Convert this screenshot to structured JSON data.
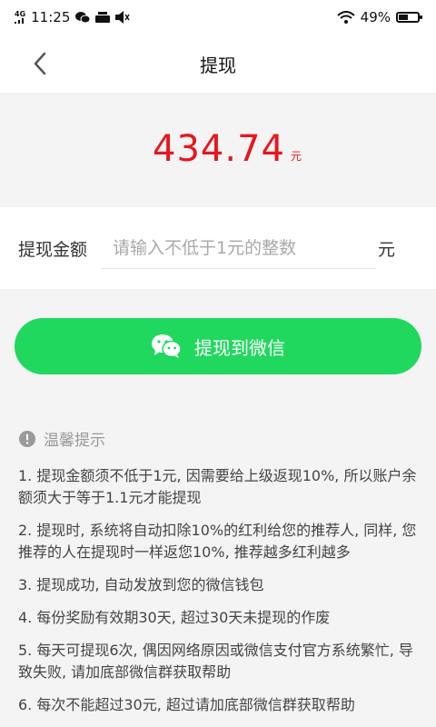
{
  "status_bar": {
    "network": "4G",
    "time": "11:25",
    "battery": "49%"
  },
  "nav": {
    "title": "提现"
  },
  "balance": {
    "amount": "434.74",
    "unit": "元"
  },
  "withdraw_form": {
    "label": "提现金额",
    "placeholder": "请输入不低于1元的整数",
    "value": "",
    "unit": "元"
  },
  "withdraw_button": {
    "label": "提现到微信",
    "icon": "wechat-icon"
  },
  "tips": {
    "title": "温馨提示",
    "items": [
      "1. 提现金额须不低于1元, 因需要给上级返现10%, 所以账户余额须大于等于1.1元才能提现",
      "2. 提现时, 系统将自动扣除10%的红利给您的推荐人, 同样, 您推荐的人在提现时一样返您10%, 推荐越多红利越多",
      "3. 提现成功, 自动发放到您的微信钱包",
      "4. 每份奖励有效期30天, 超过30天未提现的作废",
      "5. 每天可提现6次, 偶因网络原因或微信支付官方系统繁忙, 导致失败, 请加底部微信群获取帮助",
      "6. 每次不能超过30元, 超过请加底部微信群获取帮助"
    ]
  },
  "colors": {
    "accent_green": "#21d85f",
    "amount_red": "#e8161e"
  }
}
